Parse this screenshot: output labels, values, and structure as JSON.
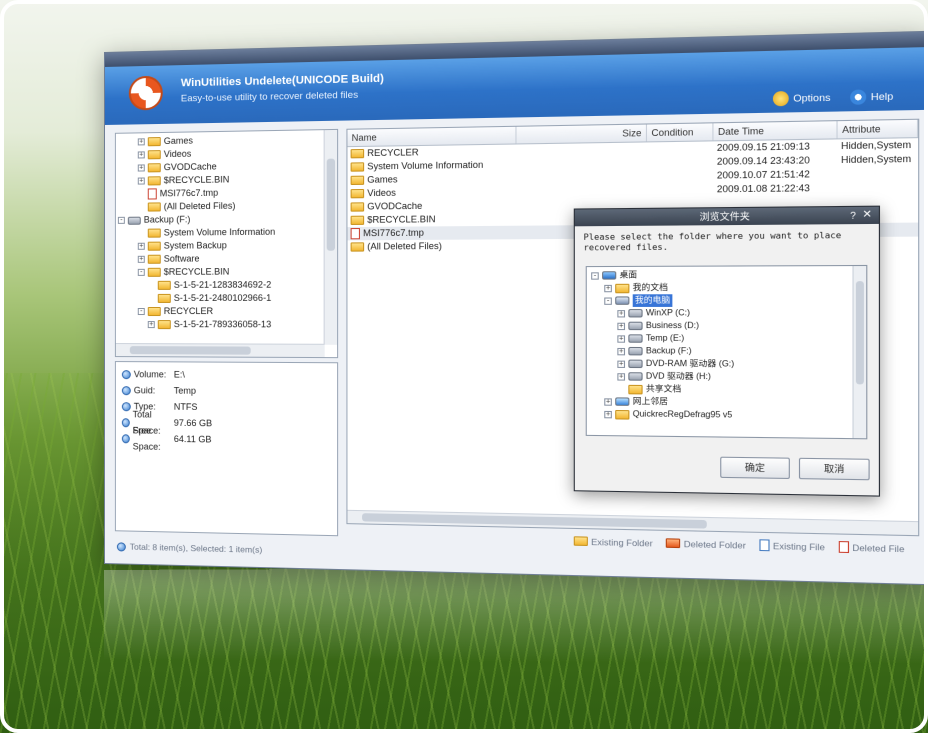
{
  "app": {
    "title": "WinUtilities Undelete(UNICODE Build)",
    "subtitle": "Easy-to-use utility to recover deleted files",
    "options_label": "Options",
    "help_label": "Help"
  },
  "tree": [
    {
      "label": "Games",
      "indent": 2,
      "icon": "folder",
      "expander": "+"
    },
    {
      "label": "Videos",
      "indent": 2,
      "icon": "folder",
      "expander": "+"
    },
    {
      "label": "GVODCache",
      "indent": 2,
      "icon": "folder",
      "expander": "+"
    },
    {
      "label": "$RECYCLE.BIN",
      "indent": 2,
      "icon": "folder",
      "expander": "+"
    },
    {
      "label": "MSI776c7.tmp",
      "indent": 2,
      "icon": "deleted-file",
      "expander": ""
    },
    {
      "label": "(All Deleted Files)",
      "indent": 2,
      "icon": "folder",
      "expander": ""
    },
    {
      "label": "Backup (F:)",
      "indent": 0,
      "icon": "drive",
      "expander": "-"
    },
    {
      "label": "System Volume Information",
      "indent": 2,
      "icon": "folder",
      "expander": ""
    },
    {
      "label": "System Backup",
      "indent": 2,
      "icon": "folder",
      "expander": "+"
    },
    {
      "label": "Software",
      "indent": 2,
      "icon": "folder",
      "expander": "+"
    },
    {
      "label": "$RECYCLE.BIN",
      "indent": 2,
      "icon": "folder",
      "expander": "-"
    },
    {
      "label": "S-1-5-21-1283834692-2",
      "indent": 3,
      "icon": "folder",
      "expander": ""
    },
    {
      "label": "S-1-5-21-2480102966-1",
      "indent": 3,
      "icon": "folder",
      "expander": ""
    },
    {
      "label": "RECYCLER",
      "indent": 2,
      "icon": "folder",
      "expander": "-"
    },
    {
      "label": "S-1-5-21-789336058-13",
      "indent": 3,
      "icon": "folder",
      "expander": "+"
    }
  ],
  "info": [
    {
      "key": "Volume:",
      "value": "E:\\"
    },
    {
      "key": "Guid:",
      "value": "Temp"
    },
    {
      "key": "Type:",
      "value": "NTFS"
    },
    {
      "key": "Total Space:",
      "value": "97.66 GB"
    },
    {
      "key": "Free Space:",
      "value": "64.11 GB"
    }
  ],
  "columns": [
    "Name",
    "Size",
    "Condition",
    "Date Time",
    "Attribute"
  ],
  "files": [
    {
      "name": "RECYCLER",
      "icon": "folder",
      "date": "2009.09.15 21:09:13",
      "attr": "Hidden,System"
    },
    {
      "name": "System Volume Information",
      "icon": "folder",
      "date": "2009.09.14 23:43:20",
      "attr": "Hidden,System"
    },
    {
      "name": "Games",
      "icon": "folder",
      "date": "2009.10.07 21:51:42",
      "attr": ""
    },
    {
      "name": "Videos",
      "icon": "folder",
      "date": "2009.01.08 21:22:43",
      "attr": ""
    },
    {
      "name": "GVODCache",
      "icon": "folder",
      "date": "",
      "attr": ""
    },
    {
      "name": "$RECYCLE.BIN",
      "icon": "folder",
      "date": "",
      "attr": ""
    },
    {
      "name": "MSI776c7.tmp",
      "icon": "deleted-file",
      "date": "",
      "attr": ""
    },
    {
      "name": "(All Deleted Files)",
      "icon": "folder",
      "date": "",
      "attr": ""
    }
  ],
  "dialog": {
    "title": "浏览文件夹",
    "close": "✕",
    "help": "?",
    "message": "Please select the folder where you want to place recovered files.",
    "tree": [
      {
        "label": "桌面",
        "indent": 0,
        "expander": "-",
        "icon": "desktop"
      },
      {
        "label": "我的文档",
        "indent": 1,
        "expander": "+",
        "icon": "folder"
      },
      {
        "label": "我的电脑",
        "indent": 1,
        "expander": "-",
        "icon": "computer",
        "selected": true
      },
      {
        "label": "WinXP (C:)",
        "indent": 2,
        "expander": "+",
        "icon": "drive"
      },
      {
        "label": "Business (D:)",
        "indent": 2,
        "expander": "+",
        "icon": "drive"
      },
      {
        "label": "Temp (E:)",
        "indent": 2,
        "expander": "+",
        "icon": "drive"
      },
      {
        "label": "Backup (F:)",
        "indent": 2,
        "expander": "+",
        "icon": "drive"
      },
      {
        "label": "DVD-RAM 驱动器 (G:)",
        "indent": 2,
        "expander": "+",
        "icon": "drive"
      },
      {
        "label": "DVD 驱动器 (H:)",
        "indent": 2,
        "expander": "+",
        "icon": "drive"
      },
      {
        "label": "共享文档",
        "indent": 2,
        "expander": "",
        "icon": "folder"
      },
      {
        "label": "网上邻居",
        "indent": 1,
        "expander": "+",
        "icon": "network"
      },
      {
        "label": "QuickrecRegDefrag95 v5",
        "indent": 1,
        "expander": "+",
        "icon": "folder"
      }
    ],
    "ok_label": "确定",
    "cancel_label": "取消"
  },
  "legend": [
    "Existing Folder",
    "Deleted Folder",
    "Existing File",
    "Deleted File"
  ],
  "status": "Total: 8 item(s),  Selected: 1 item(s)"
}
